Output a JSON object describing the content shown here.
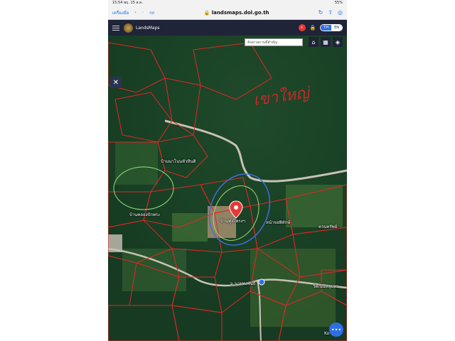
{
  "status_bar": {
    "time": "15:54",
    "date": "พฤ. 15 ส.ค.",
    "battery": "55%"
  },
  "browser": {
    "back_label": "เครื่องมือ",
    "url": "landsmaps.dol.go.th",
    "aa_label": "กก"
  },
  "app": {
    "name": "LandsMaps",
    "lang_th": "TH",
    "lang_en": "EN"
  },
  "search": {
    "placeholder": "ค้นหาสถานที่สำคัญ",
    "clear": "×"
  },
  "map_labels": {
    "village_1": "บ้านนาโนนหัวหินติ",
    "village_2": "บ้านคลองปักพระ",
    "village_3": "บ้านทุ่งโพรงฯ",
    "village_4": "หน้าจอพิทักษ์",
    "village_5": "ควนทรัพย์",
    "village_6": "ม.นายพงพันธ์",
    "village_7": "วัดเนินหลุมลา",
    "corner": "Ko"
  },
  "handwriting": "เขาใหญ่",
  "fab_label": "•••",
  "colors": {
    "parcel_line": "#e32626",
    "appbar": "#1f2438",
    "accent": "#2f6fe4",
    "pin": "#e53935"
  }
}
